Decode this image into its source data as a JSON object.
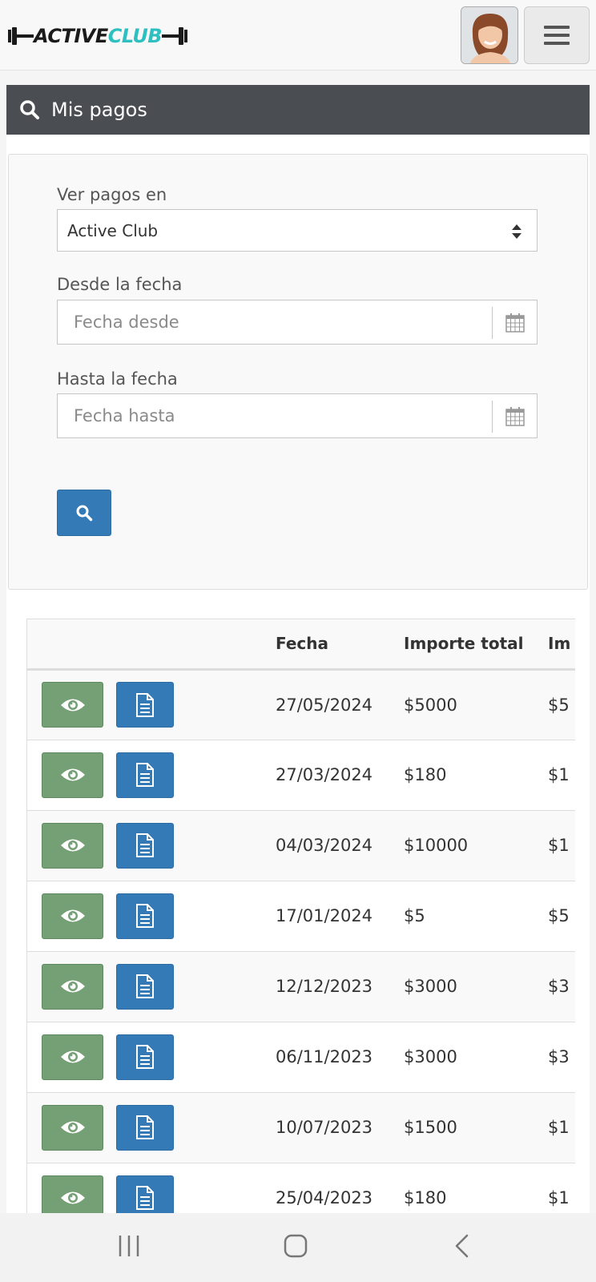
{
  "header": {
    "logo_part1": "ACTIVE",
    "logo_part2": "CLUB",
    "brand_color": "#2ebfc0"
  },
  "panel": {
    "title": "Mis pagos",
    "title_icon": "search-icon"
  },
  "filters": {
    "club_label": "Ver pagos en",
    "club_value": "Active Club",
    "from_label": "Desde la fecha",
    "from_placeholder": "Fecha desde",
    "to_label": "Hasta la fecha",
    "to_placeholder": "Fecha hasta"
  },
  "table": {
    "columns": [
      "",
      "Fecha",
      "Importe total",
      "Im"
    ],
    "rows": [
      {
        "fecha": "27/05/2024",
        "importe": "$5000",
        "extra": "$5"
      },
      {
        "fecha": "27/03/2024",
        "importe": "$180",
        "extra": "$1"
      },
      {
        "fecha": "04/03/2024",
        "importe": "$10000",
        "extra": "$1"
      },
      {
        "fecha": "17/01/2024",
        "importe": "$5",
        "extra": "$5"
      },
      {
        "fecha": "12/12/2023",
        "importe": "$3000",
        "extra": "$3"
      },
      {
        "fecha": "06/11/2023",
        "importe": "$3000",
        "extra": "$3"
      },
      {
        "fecha": "10/07/2023",
        "importe": "$1500",
        "extra": "$1"
      },
      {
        "fecha": "25/04/2023",
        "importe": "$180",
        "extra": "$1"
      }
    ]
  },
  "colors": {
    "panel_header": "#4a4e52",
    "primary": "#337ab7",
    "view_button": "#75a075"
  }
}
